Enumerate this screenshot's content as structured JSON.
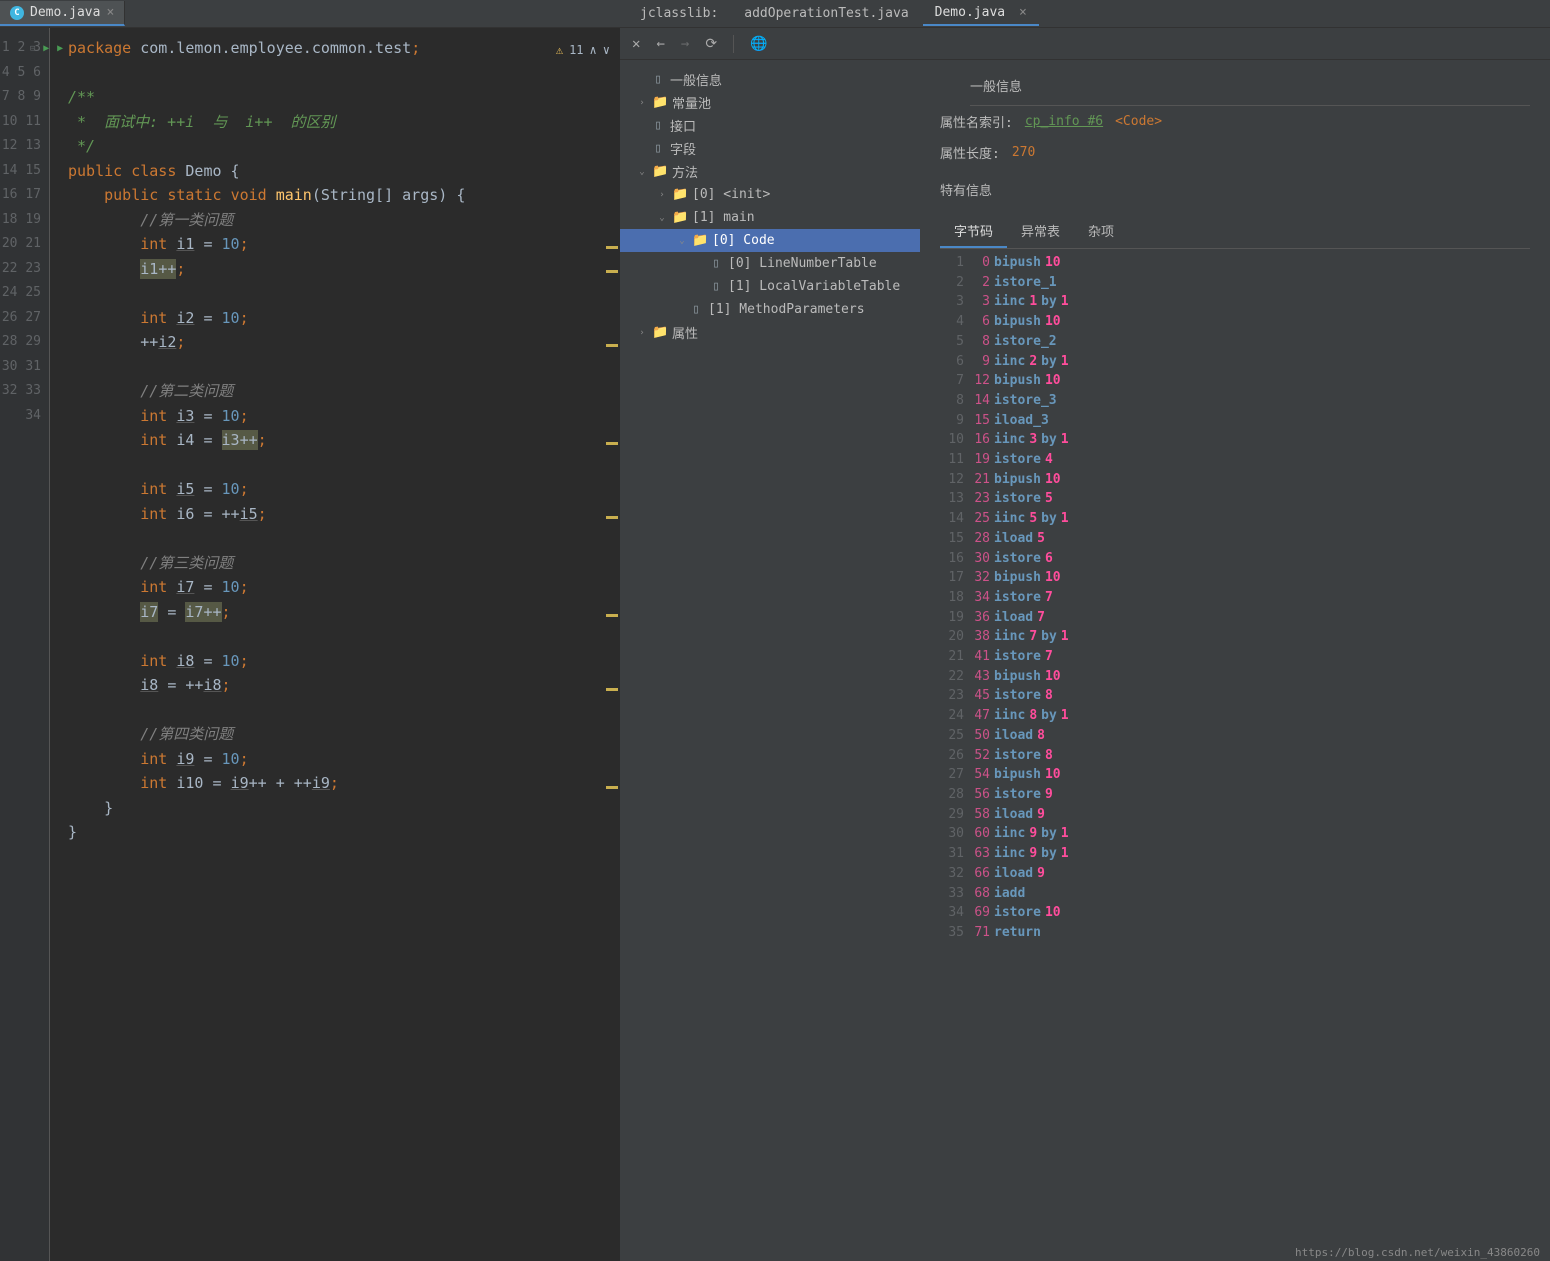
{
  "left_tab": {
    "filename": "Demo.java"
  },
  "warning": {
    "count": "11"
  },
  "code": {
    "l1_pkg": "package",
    "l1_path": "com.lemon.employee.common.test",
    "l1_end": ";",
    "l3": "/**",
    "l4": " *  面试中: ++i  与  i++  的区别",
    "l5": " */",
    "l6_pub": "public",
    "l6_cls": "class",
    "l6_name": "Demo",
    "l6_brace": " {",
    "l7_pub": "public",
    "l7_static": "static",
    "l7_void": "void",
    "l7_main": "main",
    "l7_args": "(String[] args) {",
    "l8": "//第一类问题",
    "l9_int": "int",
    "l9_var": "i1",
    "l9_eq": " = ",
    "l9_val": "10",
    "l9_sc": ";",
    "l10_var": "i1",
    "l10_op": "++",
    "l10_sc": ";",
    "l12_int": "int",
    "l12_var": "i2",
    "l12_eq": " = ",
    "l12_val": "10",
    "l12_sc": ";",
    "l13_pre": "++",
    "l13_var": "i2",
    "l13_sc": ";",
    "l15": "//第二类问题",
    "l16_int": "int",
    "l16_var": "i3",
    "l16_eq": " = ",
    "l16_val": "10",
    "l16_sc": ";",
    "l17_int": "int",
    "l17_var": "i4",
    "l17_eq": " = ",
    "l17_rhs": "i3++",
    "l17_sc": ";",
    "l19_int": "int",
    "l19_var": "i5",
    "l19_eq": " = ",
    "l19_val": "10",
    "l19_sc": ";",
    "l20_int": "int",
    "l20_var": "i6",
    "l20_eq": " = ++",
    "l20_rhs": "i5",
    "l20_sc": ";",
    "l22": "//第三类问题",
    "l23_int": "int",
    "l23_var": "i7",
    "l23_eq": " = ",
    "l23_val": "10",
    "l23_sc": ";",
    "l24_var": "i7",
    "l24_eq": " = ",
    "l24_rhs": "i7++",
    "l24_sc": ";",
    "l26_int": "int",
    "l26_var": "i8",
    "l26_eq": " = ",
    "l26_val": "10",
    "l26_sc": ";",
    "l27_var": "i8",
    "l27_eq": " = ++",
    "l27_rhs": "i8",
    "l27_sc": ";",
    "l29": "//第四类问题",
    "l30_int": "int",
    "l30_var": "i9",
    "l30_eq": " = ",
    "l30_val": "10",
    "l30_sc": ";",
    "l31_int": "int",
    "l31_var": "i10",
    "l31_eq": " = ",
    "l31_r1": "i9",
    "l31_op1": "++ + ++",
    "l31_r2": "i9",
    "l31_sc": ";",
    "l32": "}",
    "l33": "}"
  },
  "right_tabs": {
    "t1": "jclasslib:",
    "t2": "addOperationTest.java",
    "t3": "Demo.java"
  },
  "tree": {
    "general": "一般信息",
    "constpool": "常量池",
    "iface": "接口",
    "fields": "字段",
    "methods": "方法",
    "init": "[0] <init>",
    "main": "[1] main",
    "code": "[0] Code",
    "lnt": "[0] LineNumberTable",
    "lvt": "[1] LocalVariableTable",
    "mp": "[1] MethodParameters",
    "attrs": "属性"
  },
  "detail": {
    "header": "一般信息",
    "row1_label": "属性名索引:",
    "row1_link": "cp_info #6",
    "row1_val": "<Code>",
    "row2_label": "属性长度:",
    "row2_val": "270",
    "special": "特有信息"
  },
  "inner_tabs": {
    "t1": "字节码",
    "t2": "异常表",
    "t3": "杂项"
  },
  "bytecode": [
    {
      "ln": "1",
      "off": "0",
      "instr": "bipush",
      "a1": "10"
    },
    {
      "ln": "2",
      "off": "2",
      "instr": "istore_1"
    },
    {
      "ln": "3",
      "off": "3",
      "instr": "iinc",
      "a1": "1",
      "by": "by",
      "a2": "1"
    },
    {
      "ln": "4",
      "off": "6",
      "instr": "bipush",
      "a1": "10"
    },
    {
      "ln": "5",
      "off": "8",
      "instr": "istore_2"
    },
    {
      "ln": "6",
      "off": "9",
      "instr": "iinc",
      "a1": "2",
      "by": "by",
      "a2": "1"
    },
    {
      "ln": "7",
      "off": "12",
      "instr": "bipush",
      "a1": "10"
    },
    {
      "ln": "8",
      "off": "14",
      "instr": "istore_3"
    },
    {
      "ln": "9",
      "off": "15",
      "instr": "iload_3"
    },
    {
      "ln": "10",
      "off": "16",
      "instr": "iinc",
      "a1": "3",
      "by": "by",
      "a2": "1"
    },
    {
      "ln": "11",
      "off": "19",
      "instr": "istore",
      "a1": "4"
    },
    {
      "ln": "12",
      "off": "21",
      "instr": "bipush",
      "a1": "10"
    },
    {
      "ln": "13",
      "off": "23",
      "instr": "istore",
      "a1": "5"
    },
    {
      "ln": "14",
      "off": "25",
      "instr": "iinc",
      "a1": "5",
      "by": "by",
      "a2": "1"
    },
    {
      "ln": "15",
      "off": "28",
      "instr": "iload",
      "a1": "5"
    },
    {
      "ln": "16",
      "off": "30",
      "instr": "istore",
      "a1": "6"
    },
    {
      "ln": "17",
      "off": "32",
      "instr": "bipush",
      "a1": "10"
    },
    {
      "ln": "18",
      "off": "34",
      "instr": "istore",
      "a1": "7"
    },
    {
      "ln": "19",
      "off": "36",
      "instr": "iload",
      "a1": "7"
    },
    {
      "ln": "20",
      "off": "38",
      "instr": "iinc",
      "a1": "7",
      "by": "by",
      "a2": "1"
    },
    {
      "ln": "21",
      "off": "41",
      "instr": "istore",
      "a1": "7"
    },
    {
      "ln": "22",
      "off": "43",
      "instr": "bipush",
      "a1": "10"
    },
    {
      "ln": "23",
      "off": "45",
      "instr": "istore",
      "a1": "8"
    },
    {
      "ln": "24",
      "off": "47",
      "instr": "iinc",
      "a1": "8",
      "by": "by",
      "a2": "1"
    },
    {
      "ln": "25",
      "off": "50",
      "instr": "iload",
      "a1": "8"
    },
    {
      "ln": "26",
      "off": "52",
      "instr": "istore",
      "a1": "8"
    },
    {
      "ln": "27",
      "off": "54",
      "instr": "bipush",
      "a1": "10"
    },
    {
      "ln": "28",
      "off": "56",
      "instr": "istore",
      "a1": "9"
    },
    {
      "ln": "29",
      "off": "58",
      "instr": "iload",
      "a1": "9"
    },
    {
      "ln": "30",
      "off": "60",
      "instr": "iinc",
      "a1": "9",
      "by": "by",
      "a2": "1"
    },
    {
      "ln": "31",
      "off": "63",
      "instr": "iinc",
      "a1": "9",
      "by": "by",
      "a2": "1"
    },
    {
      "ln": "32",
      "off": "66",
      "instr": "iload",
      "a1": "9"
    },
    {
      "ln": "33",
      "off": "68",
      "instr": "iadd"
    },
    {
      "ln": "34",
      "off": "69",
      "instr": "istore",
      "a1": "10"
    },
    {
      "ln": "35",
      "off": "71",
      "instr": "return"
    }
  ],
  "watermark": "https://blog.csdn.net/weixin_43860260"
}
